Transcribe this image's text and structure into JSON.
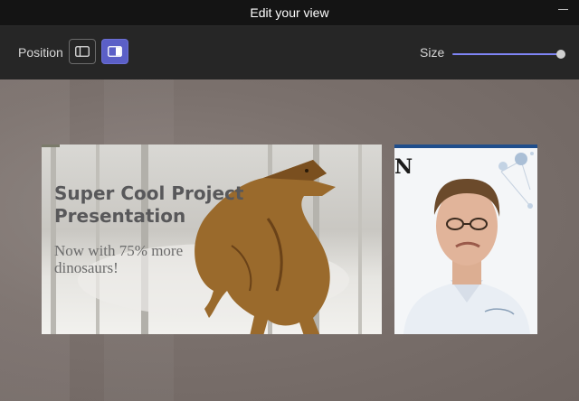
{
  "window": {
    "title": "Edit your view"
  },
  "toolbar": {
    "position_label": "Position",
    "size_label": "Size",
    "size_value": 1.0,
    "selected_position": "right"
  },
  "slide": {
    "title": "Super Cool Project Presentation",
    "subtitle": "Now with 75% more dinosaurs!"
  },
  "video": {
    "logo_text": "N"
  },
  "colors": {
    "accent": "#5b5fc7",
    "slider": "#7f85f5"
  }
}
